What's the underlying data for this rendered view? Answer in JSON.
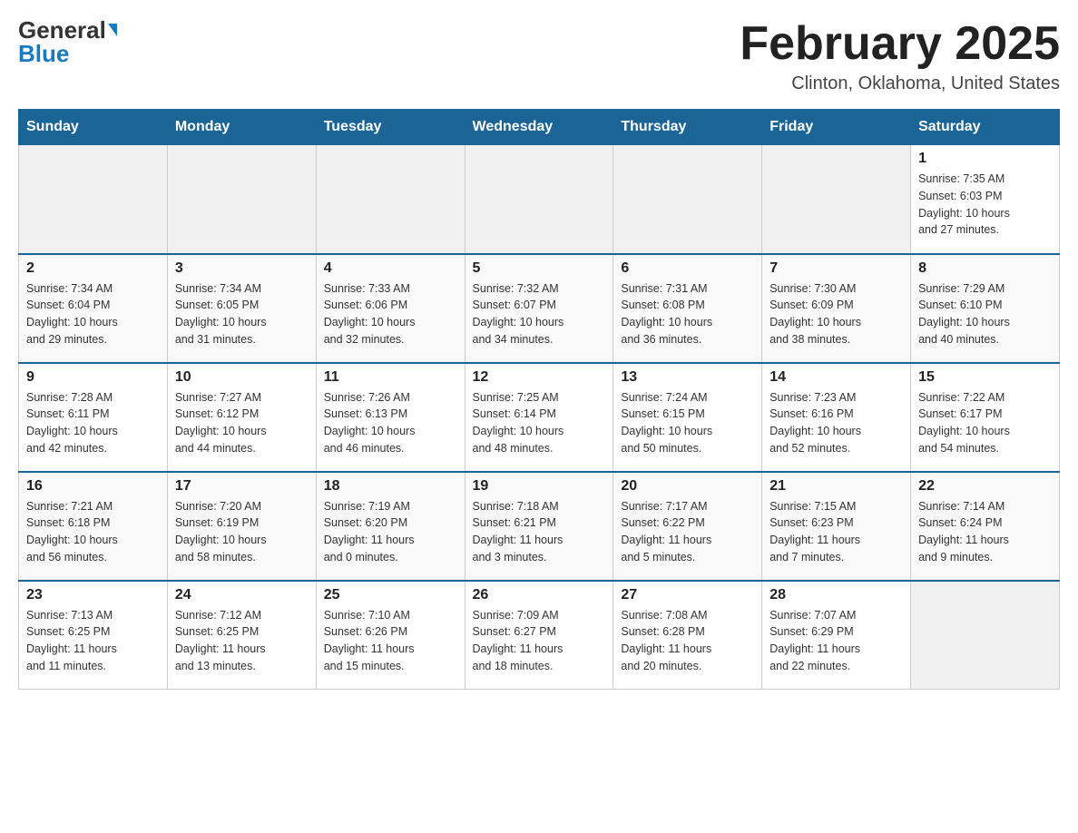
{
  "header": {
    "logo_general": "General",
    "logo_blue": "Blue",
    "month_title": "February 2025",
    "location": "Clinton, Oklahoma, United States"
  },
  "days_of_week": [
    "Sunday",
    "Monday",
    "Tuesday",
    "Wednesday",
    "Thursday",
    "Friday",
    "Saturday"
  ],
  "weeks": [
    [
      {
        "day": "",
        "info": ""
      },
      {
        "day": "",
        "info": ""
      },
      {
        "day": "",
        "info": ""
      },
      {
        "day": "",
        "info": ""
      },
      {
        "day": "",
        "info": ""
      },
      {
        "day": "",
        "info": ""
      },
      {
        "day": "1",
        "info": "Sunrise: 7:35 AM\nSunset: 6:03 PM\nDaylight: 10 hours\nand 27 minutes."
      }
    ],
    [
      {
        "day": "2",
        "info": "Sunrise: 7:34 AM\nSunset: 6:04 PM\nDaylight: 10 hours\nand 29 minutes."
      },
      {
        "day": "3",
        "info": "Sunrise: 7:34 AM\nSunset: 6:05 PM\nDaylight: 10 hours\nand 31 minutes."
      },
      {
        "day": "4",
        "info": "Sunrise: 7:33 AM\nSunset: 6:06 PM\nDaylight: 10 hours\nand 32 minutes."
      },
      {
        "day": "5",
        "info": "Sunrise: 7:32 AM\nSunset: 6:07 PM\nDaylight: 10 hours\nand 34 minutes."
      },
      {
        "day": "6",
        "info": "Sunrise: 7:31 AM\nSunset: 6:08 PM\nDaylight: 10 hours\nand 36 minutes."
      },
      {
        "day": "7",
        "info": "Sunrise: 7:30 AM\nSunset: 6:09 PM\nDaylight: 10 hours\nand 38 minutes."
      },
      {
        "day": "8",
        "info": "Sunrise: 7:29 AM\nSunset: 6:10 PM\nDaylight: 10 hours\nand 40 minutes."
      }
    ],
    [
      {
        "day": "9",
        "info": "Sunrise: 7:28 AM\nSunset: 6:11 PM\nDaylight: 10 hours\nand 42 minutes."
      },
      {
        "day": "10",
        "info": "Sunrise: 7:27 AM\nSunset: 6:12 PM\nDaylight: 10 hours\nand 44 minutes."
      },
      {
        "day": "11",
        "info": "Sunrise: 7:26 AM\nSunset: 6:13 PM\nDaylight: 10 hours\nand 46 minutes."
      },
      {
        "day": "12",
        "info": "Sunrise: 7:25 AM\nSunset: 6:14 PM\nDaylight: 10 hours\nand 48 minutes."
      },
      {
        "day": "13",
        "info": "Sunrise: 7:24 AM\nSunset: 6:15 PM\nDaylight: 10 hours\nand 50 minutes."
      },
      {
        "day": "14",
        "info": "Sunrise: 7:23 AM\nSunset: 6:16 PM\nDaylight: 10 hours\nand 52 minutes."
      },
      {
        "day": "15",
        "info": "Sunrise: 7:22 AM\nSunset: 6:17 PM\nDaylight: 10 hours\nand 54 minutes."
      }
    ],
    [
      {
        "day": "16",
        "info": "Sunrise: 7:21 AM\nSunset: 6:18 PM\nDaylight: 10 hours\nand 56 minutes."
      },
      {
        "day": "17",
        "info": "Sunrise: 7:20 AM\nSunset: 6:19 PM\nDaylight: 10 hours\nand 58 minutes."
      },
      {
        "day": "18",
        "info": "Sunrise: 7:19 AM\nSunset: 6:20 PM\nDaylight: 11 hours\nand 0 minutes."
      },
      {
        "day": "19",
        "info": "Sunrise: 7:18 AM\nSunset: 6:21 PM\nDaylight: 11 hours\nand 3 minutes."
      },
      {
        "day": "20",
        "info": "Sunrise: 7:17 AM\nSunset: 6:22 PM\nDaylight: 11 hours\nand 5 minutes."
      },
      {
        "day": "21",
        "info": "Sunrise: 7:15 AM\nSunset: 6:23 PM\nDaylight: 11 hours\nand 7 minutes."
      },
      {
        "day": "22",
        "info": "Sunrise: 7:14 AM\nSunset: 6:24 PM\nDaylight: 11 hours\nand 9 minutes."
      }
    ],
    [
      {
        "day": "23",
        "info": "Sunrise: 7:13 AM\nSunset: 6:25 PM\nDaylight: 11 hours\nand 11 minutes."
      },
      {
        "day": "24",
        "info": "Sunrise: 7:12 AM\nSunset: 6:25 PM\nDaylight: 11 hours\nand 13 minutes."
      },
      {
        "day": "25",
        "info": "Sunrise: 7:10 AM\nSunset: 6:26 PM\nDaylight: 11 hours\nand 15 minutes."
      },
      {
        "day": "26",
        "info": "Sunrise: 7:09 AM\nSunset: 6:27 PM\nDaylight: 11 hours\nand 18 minutes."
      },
      {
        "day": "27",
        "info": "Sunrise: 7:08 AM\nSunset: 6:28 PM\nDaylight: 11 hours\nand 20 minutes."
      },
      {
        "day": "28",
        "info": "Sunrise: 7:07 AM\nSunset: 6:29 PM\nDaylight: 11 hours\nand 22 minutes."
      },
      {
        "day": "",
        "info": ""
      }
    ]
  ]
}
